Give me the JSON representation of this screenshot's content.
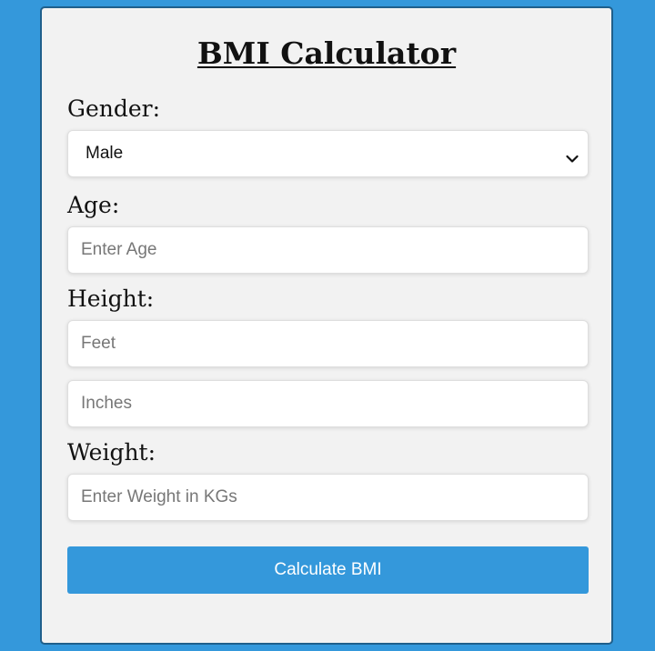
{
  "title": "BMI Calculator",
  "gender": {
    "label": "Gender:",
    "selected": "Male",
    "icon": "chevron-down-icon"
  },
  "age": {
    "label": "Age:",
    "placeholder": "Enter Age",
    "value": ""
  },
  "height": {
    "label": "Height:",
    "feet_placeholder": "Feet",
    "inches_placeholder": "Inches"
  },
  "weight": {
    "label": "Weight:",
    "placeholder": "Enter Weight in KGs"
  },
  "button": {
    "label": "Calculate BMI"
  },
  "colors": {
    "background": "#3498db",
    "card": "#f2f2f2",
    "button": "#3498db"
  }
}
